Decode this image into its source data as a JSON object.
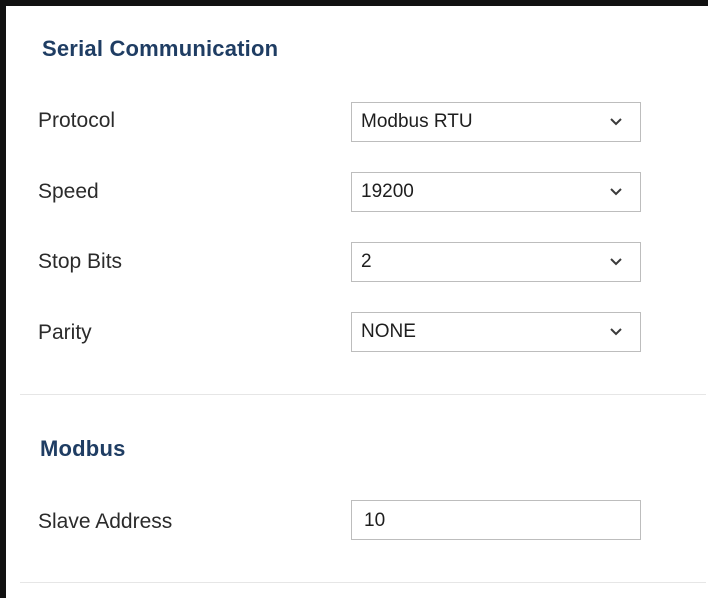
{
  "serial": {
    "title": "Serial Communication",
    "protocol": {
      "label": "Protocol",
      "value": "Modbus RTU"
    },
    "speed": {
      "label": "Speed",
      "value": "19200"
    },
    "stop_bits": {
      "label": "Stop Bits",
      "value": "2"
    },
    "parity": {
      "label": "Parity",
      "value": "NONE"
    }
  },
  "modbus": {
    "title": "Modbus",
    "slave_address": {
      "label": "Slave Address",
      "value": "10"
    }
  },
  "icons": {
    "dropdown": "chevron-down-icon"
  },
  "colors": {
    "section_title": "#1f3d63",
    "border": "#bdbdbd"
  }
}
